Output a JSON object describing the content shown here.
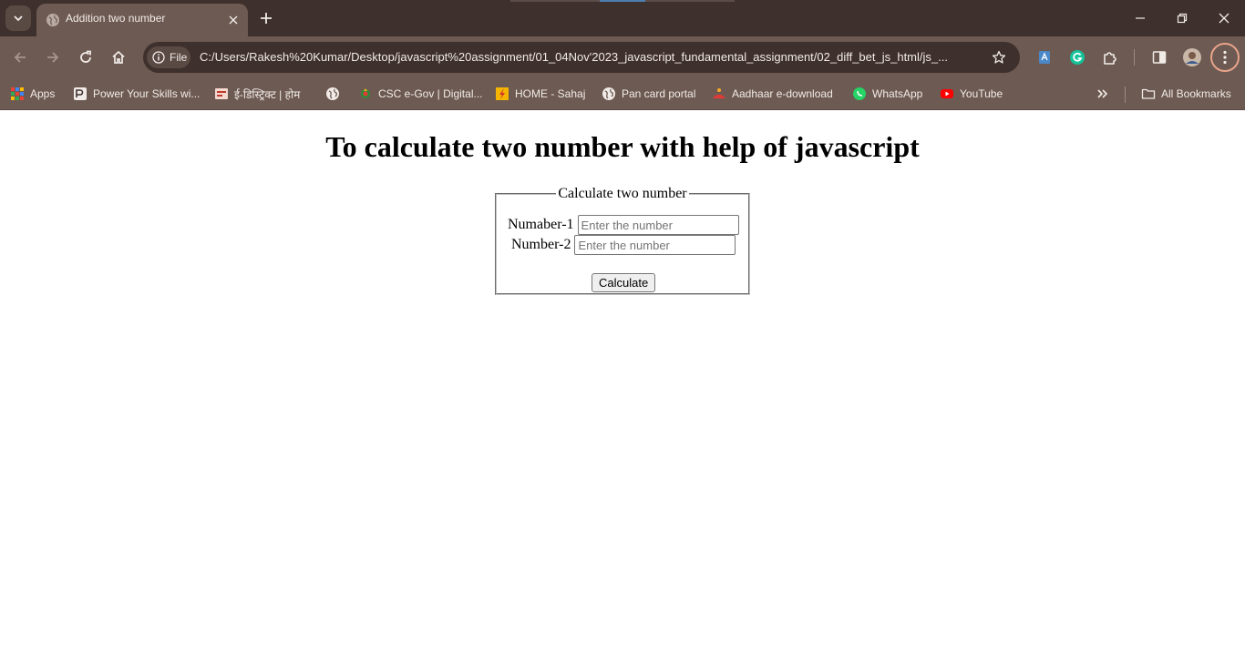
{
  "browser": {
    "tab": {
      "title": "Addition two number"
    },
    "omnibox": {
      "chip_label": "File",
      "url": "C:/Users/Rakesh%20Kumar/Desktop/javascript%20assignment/01_04Nov'2023_javascript_fundamental_assignment/02_diff_bet_js_html/js_..."
    },
    "bookmarks": [
      {
        "label": "Apps",
        "icon": "apps-grid-icon"
      },
      {
        "label": "Power Your Skills wi...",
        "icon": "site-icon"
      },
      {
        "label": "ई-डिस्ट्रिक्ट | होम",
        "icon": "edistrict-icon"
      },
      {
        "label": "",
        "icon": "globe-icon"
      },
      {
        "label": "CSC e-Gov | Digital...",
        "icon": "csc-icon"
      },
      {
        "label": "HOME - Sahaj",
        "icon": "sahaj-icon"
      },
      {
        "label": "Pan card portal",
        "icon": "globe-icon"
      },
      {
        "label": "Aadhaar e-download",
        "icon": "aadhaar-icon"
      },
      {
        "label": "WhatsApp",
        "icon": "whatsapp-icon"
      },
      {
        "label": "YouTube",
        "icon": "youtube-icon"
      }
    ],
    "all_bookmarks_label": "All Bookmarks"
  },
  "page": {
    "heading": "To calculate two number with help of javascript",
    "form": {
      "legend": "Calculate two number",
      "field1_label": "Numaber-1",
      "field1_placeholder": "Enter the number",
      "field1_value": "",
      "field2_label": "Number-2",
      "field2_placeholder": "Enter the number",
      "field2_value": "",
      "button_label": "Calculate"
    }
  },
  "colors": {
    "tabstrip_bg": "#3e302c",
    "toolbar_bg": "#6d5a52",
    "text_light": "#f1ebe8",
    "profile_ring": "#e8a48a"
  }
}
